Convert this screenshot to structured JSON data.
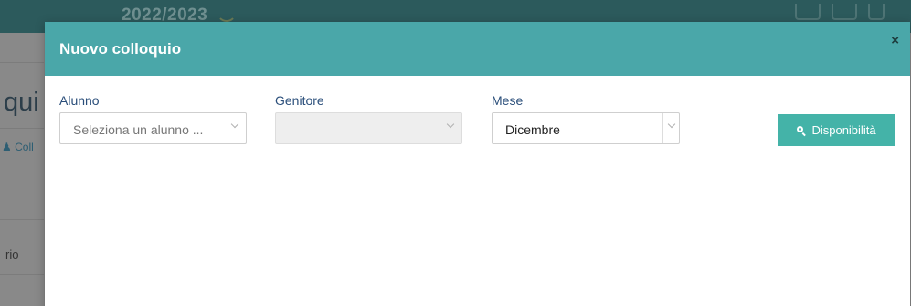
{
  "background": {
    "year": "2022/2023",
    "title_fragment": "qui",
    "link_fragment": "Coll",
    "side_fragment": "rio"
  },
  "modal": {
    "title": "Nuovo colloquio",
    "close_symbol": "×",
    "fields": {
      "alunno": {
        "label": "Alunno",
        "placeholder": "Seleziona un alunno ..."
      },
      "genitore": {
        "label": "Genitore",
        "value": ""
      },
      "mese": {
        "label": "Mese",
        "value": "Dicembre"
      }
    },
    "search_button": "Disponibilità"
  },
  "colors": {
    "header": "#4aa7a9",
    "button": "#44b3a8",
    "label": "#2a4e7a"
  }
}
